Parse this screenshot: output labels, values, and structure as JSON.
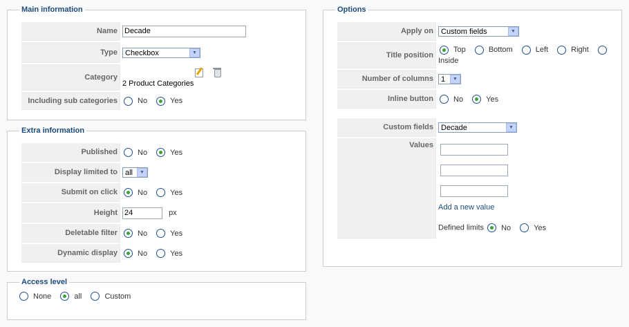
{
  "main_info": {
    "legend": "Main information",
    "name_label": "Name",
    "name_value": "Decade",
    "type_label": "Type",
    "type_value": "Checkbox",
    "category_label": "Category",
    "category_value": "2 Product Categories",
    "sub_label": "Including sub categories",
    "no": "No",
    "yes": "Yes"
  },
  "extra_info": {
    "legend": "Extra information",
    "published_label": "Published",
    "display_label": "Display limited to",
    "display_value": "all",
    "submit_label": "Submit on click",
    "height_label": "Height",
    "height_value": "24",
    "height_unit": "px",
    "deletable_label": "Deletable filter",
    "dynamic_label": "Dynamic display",
    "no": "No",
    "yes": "Yes"
  },
  "access": {
    "legend": "Access level",
    "none": "None",
    "all": "all",
    "custom": "Custom"
  },
  "options": {
    "legend": "Options",
    "apply_label": "Apply on",
    "apply_value": "Custom fields",
    "title_label": "Title position",
    "top": "Top",
    "bottom": "Bottom",
    "left": "Left",
    "right": "Right",
    "inside": "Inside",
    "columns_label": "Number of columns",
    "columns_value": "1",
    "inline_label": "Inline button",
    "no": "No",
    "yes": "Yes",
    "custom_fields_label": "Custom fields",
    "custom_fields_value": "Decade",
    "values_label": "Values",
    "add_value": "Add a new value",
    "defined_limits": "Defined limits"
  }
}
